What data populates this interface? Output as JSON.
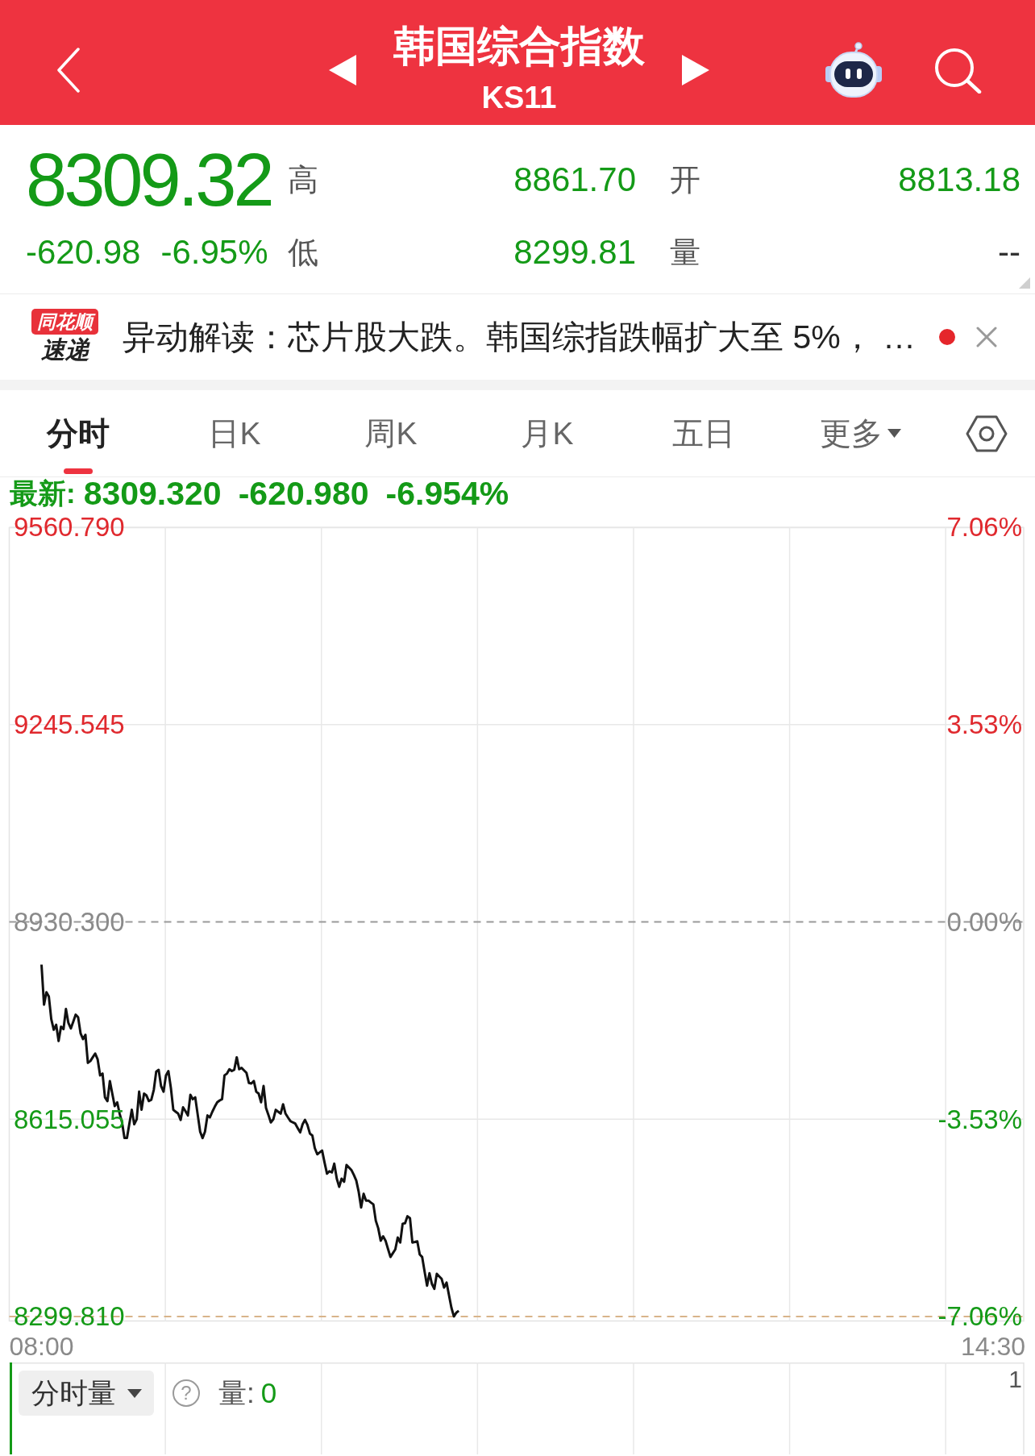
{
  "header": {
    "title": "韩国综合指数",
    "code": "KS11"
  },
  "quote": {
    "price": "8309.32",
    "change": "-620.98",
    "change_percent": "-6.95%",
    "stats": [
      {
        "label": "高",
        "value": "8861.70",
        "color": "#149a17"
      },
      {
        "label": "开",
        "value": "8813.18",
        "color": "#149a17"
      },
      {
        "label": "低",
        "value": "8299.81",
        "color": "#149a17"
      },
      {
        "label": "量",
        "value": "--",
        "color": "#333333"
      }
    ]
  },
  "news": {
    "source_tag": "同花顺",
    "source_label": "速递",
    "text": "异动解读：芯片股大跌。韩国综指跌幅扩大至 5%， …",
    "unread": true
  },
  "tabs": [
    {
      "label": "分时",
      "selected": true,
      "kind": "tab"
    },
    {
      "label": "日K",
      "selected": false,
      "kind": "tab"
    },
    {
      "label": "周K",
      "selected": false,
      "kind": "tab"
    },
    {
      "label": "月K",
      "selected": false,
      "kind": "tab"
    },
    {
      "label": "五日",
      "selected": false,
      "kind": "tab"
    },
    {
      "label": "更多",
      "selected": false,
      "kind": "menu"
    }
  ],
  "latest": {
    "label": "最新:",
    "price": "8309.320",
    "change": "-620.980",
    "percent": "-6.954%"
  },
  "intraday_chart": {
    "right_labels": [
      "7.06%",
      "3.53%",
      "0.00%",
      "-3.53%",
      "-7.06%"
    ],
    "chart_data": {
      "type": "line",
      "categories": [
        "08:00",
        null,
        null,
        null,
        null,
        null,
        null,
        null,
        null,
        null,
        null,
        null,
        null,
        null,
        null,
        null,
        null,
        null,
        null,
        null,
        null,
        null,
        null,
        null,
        null,
        null,
        null,
        null,
        null,
        null,
        null,
        null,
        null,
        null,
        null,
        null,
        null,
        null,
        null,
        null,
        null,
        null,
        null,
        null,
        null,
        null,
        null,
        null,
        null,
        null,
        null,
        null,
        null,
        null,
        null,
        null,
        null,
        null,
        null,
        null,
        null,
        null,
        null,
        null,
        null,
        null,
        null,
        null,
        null,
        null,
        null,
        null,
        null,
        null,
        null,
        null,
        null,
        null,
        null,
        null,
        null,
        null,
        null,
        null,
        null,
        null,
        null,
        null,
        null,
        null,
        null,
        null,
        null,
        null,
        null,
        null,
        null,
        null,
        null,
        null,
        null,
        null,
        null,
        null,
        null,
        null,
        null,
        null,
        null,
        null,
        null,
        null,
        null,
        null,
        null,
        null,
        null,
        null,
        null,
        null,
        null,
        null,
        null,
        null,
        null,
        null,
        null,
        null,
        null,
        null,
        null,
        null,
        null,
        null,
        null,
        null,
        null,
        null,
        null,
        null,
        null,
        null,
        null,
        null,
        null,
        null,
        null,
        null,
        null,
        null,
        null,
        null,
        null,
        null,
        null,
        null,
        null,
        null,
        null,
        null,
        null,
        null,
        null,
        null,
        null,
        null,
        null,
        null,
        null,
        null,
        null,
        null,
        null,
        null,
        null,
        null,
        null,
        null,
        null,
        null,
        null,
        null,
        null,
        null,
        null,
        null,
        null,
        null,
        null,
        null,
        null,
        null,
        null,
        null,
        null,
        null,
        null,
        null,
        null,
        null,
        null,
        null,
        null,
        null,
        null,
        null,
        null,
        null,
        null,
        null,
        null,
        null,
        null,
        null,
        null,
        null,
        null,
        null,
        null,
        null,
        null,
        null,
        null,
        null,
        null,
        null,
        null,
        null,
        null,
        null,
        null,
        null,
        null,
        null,
        null,
        null,
        null,
        null,
        null,
        null,
        null,
        null,
        null,
        null,
        null,
        null,
        null,
        null,
        null,
        null,
        null,
        null,
        null,
        null,
        null,
        null,
        null,
        null,
        null,
        null,
        null,
        null,
        null,
        null,
        null,
        null,
        null,
        null,
        null,
        null,
        null,
        null,
        null,
        null,
        null,
        null,
        null,
        null,
        null,
        null,
        null,
        null,
        null,
        null,
        null,
        null,
        null,
        null,
        null,
        null,
        null,
        null,
        null,
        null,
        null,
        null,
        null,
        null,
        null,
        null,
        null,
        null,
        null,
        null,
        null,
        null,
        null,
        null,
        null,
        null,
        null,
        null,
        null,
        null,
        null,
        null,
        null,
        null,
        null,
        null,
        null,
        null,
        null,
        null,
        null,
        null,
        null,
        null,
        null,
        null,
        null,
        null,
        null,
        null,
        null,
        null,
        null,
        null,
        null,
        null,
        null,
        null,
        null,
        null,
        null,
        null,
        null,
        null,
        null,
        null,
        null,
        null,
        null,
        null,
        null,
        null,
        null,
        null,
        null,
        null,
        null,
        null,
        null,
        null,
        null,
        null,
        null,
        null,
        null,
        null,
        null,
        null,
        null,
        null,
        null,
        null,
        null,
        null,
        null,
        null,
        null,
        null,
        null,
        null,
        null,
        null,
        null,
        null,
        null,
        null,
        "14:30"
      ],
      "values": [
        8862,
        8798,
        8818,
        8811,
        8775,
        8758,
        8766,
        8740,
        8763,
        8759,
        8791,
        8769,
        8760,
        8771,
        8782,
        8778,
        8752,
        8743,
        8750,
        8705,
        8708,
        8714,
        8720,
        8711,
        8685,
        8688,
        8650,
        8644,
        8676,
        8656,
        8636,
        8642,
        8624,
        8610,
        8585,
        8585,
        8608,
        8630,
        8607,
        8615,
        8659,
        8630,
        8656,
        8653,
        8644,
        8646,
        8662,
        8691,
        8694,
        8668,
        8659,
        8685,
        8692,
        8665,
        8630,
        8627,
        8624,
        8614,
        8634,
        8628,
        8621,
        8654,
        8647,
        8650,
        8623,
        8595,
        8585,
        8595,
        8621,
        8618,
        8627,
        8635,
        8642,
        8645,
        8647,
        8685,
        8688,
        8695,
        8692,
        8694,
        8714,
        8695,
        8697,
        8693,
        8689,
        8673,
        8672,
        8676,
        8659,
        8656,
        8642,
        8668,
        8633,
        8622,
        8610,
        8615,
        8630,
        8627,
        8624,
        8639,
        8624,
        8618,
        8612,
        8610,
        8608,
        8601,
        8594,
        8607,
        8614,
        8606,
        8592,
        8589,
        8569,
        8559,
        8562,
        8565,
        8546,
        8528,
        8532,
        8530,
        8544,
        8520,
        8507,
        8520,
        8515,
        8542,
        8538,
        8534,
        8526,
        8517,
        8499,
        8474,
        8496,
        8485,
        8485,
        8482,
        8479,
        8453,
        8441,
        8421,
        8428,
        8421,
        8408,
        8395,
        8401,
        8407,
        8426,
        8418,
        8448,
        8449,
        8460,
        8457,
        8418,
        8419,
        8420,
        8399,
        8395,
        8372,
        8349,
        8369,
        8352,
        8344,
        8368,
        8364,
        8360,
        8346,
        8354,
        8334,
        8314,
        8300,
        8306,
        8309,
        null,
        null,
        null,
        null,
        null,
        null,
        null,
        null,
        null,
        null,
        null,
        null,
        null,
        null,
        null,
        null,
        null,
        null,
        null,
        null,
        null,
        null,
        null,
        null,
        null,
        null,
        null,
        null,
        null,
        null,
        null,
        null,
        null,
        null,
        null,
        null,
        null,
        null,
        null,
        null,
        null,
        null,
        null,
        null,
        null,
        null,
        null,
        null,
        null,
        null,
        null,
        null,
        null,
        null,
        null,
        null,
        null,
        null,
        null,
        null,
        null,
        null,
        null,
        null,
        null,
        null,
        null,
        null,
        null,
        null,
        null,
        null,
        null,
        null,
        null,
        null,
        null,
        null,
        null,
        null,
        null,
        null,
        null,
        null,
        null,
        null,
        null,
        null,
        null,
        null,
        null,
        null,
        null,
        null,
        null,
        null,
        null,
        null,
        null,
        null,
        null,
        null,
        null,
        null,
        null,
        null,
        null,
        null,
        null,
        null,
        null,
        null,
        null,
        null,
        null,
        null,
        null,
        null,
        null,
        null,
        null,
        null,
        null,
        null,
        null,
        null,
        null,
        null,
        null,
        null,
        null,
        null,
        null,
        null,
        null,
        null,
        null,
        null,
        null,
        null,
        null,
        null,
        null,
        null,
        null,
        null,
        null,
        null,
        null,
        null,
        null,
        null,
        null,
        null,
        null,
        null,
        null,
        null,
        null,
        null,
        null,
        null,
        null,
        null,
        null,
        null,
        null,
        null,
        null,
        null,
        null,
        null,
        null,
        null,
        null,
        null,
        null,
        null,
        null,
        null,
        null,
        null,
        null,
        null,
        null,
        null,
        null,
        null,
        null,
        null,
        null,
        null,
        null,
        null,
        null,
        null,
        null,
        null,
        null,
        null,
        null,
        null,
        null,
        null,
        null,
        null,
        null,
        null,
        null,
        null,
        null,
        null,
        null,
        null,
        null,
        null,
        null,
        null,
        null
      ],
      "ylim": [
        8299.81,
        9560.79
      ],
      "yticks": [
        {
          "value": 9560.79,
          "label": "9560.790"
        },
        {
          "value": 9245.545,
          "label": "9245.545"
        },
        {
          "value": 8930.3,
          "label": "8930.300"
        },
        {
          "value": 8615.055,
          "label": "8615.055"
        },
        {
          "value": 8299.81,
          "label": "8299.810"
        }
      ],
      "ref_lines": [
        {
          "axis": "y",
          "value": 8930.3,
          "color": "#9a9a9a"
        },
        {
          "axis": "y",
          "value": 8299.81,
          "color": "#d8b48a"
        }
      ]
    }
  },
  "volume_panel": {
    "selector": "分时量",
    "help": "?",
    "label": "量:",
    "value": "0",
    "axis_max": "1"
  }
}
